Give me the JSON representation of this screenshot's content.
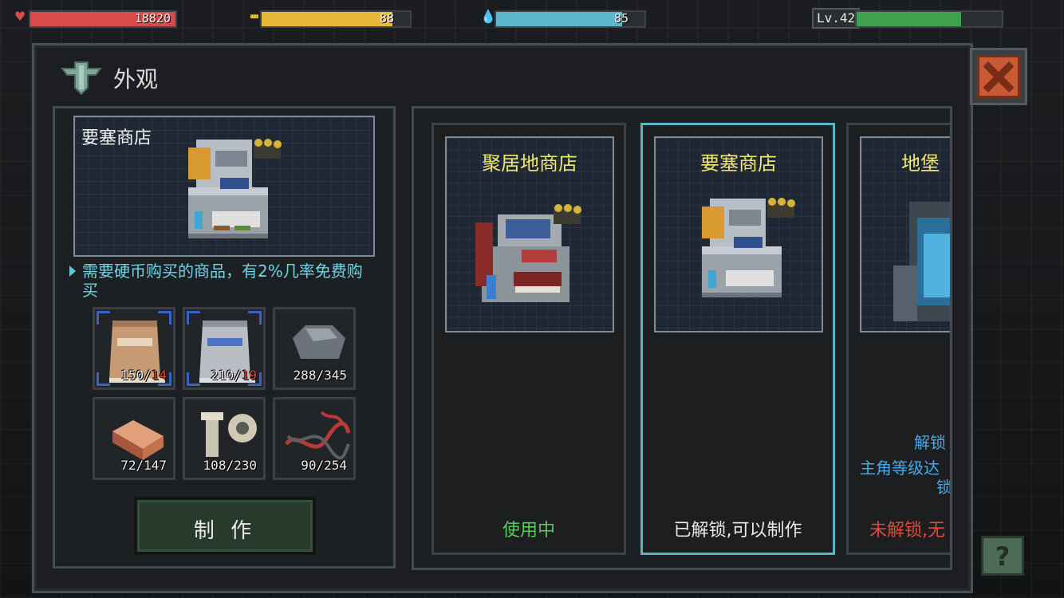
{
  "hud": {
    "health": {
      "value": "18820",
      "fill": 1.0,
      "color": "#d94a4a",
      "icon": "heart-icon"
    },
    "food": {
      "value": "88",
      "fill": 0.88,
      "color": "#e7b93a",
      "icon": "burger-icon"
    },
    "water": {
      "value": "85",
      "fill": 0.85,
      "color": "#5fb7cf",
      "icon": "water-drop-icon"
    },
    "level": {
      "label": "Lv.42",
      "fill": 0.72,
      "color": "#3fa04d"
    }
  },
  "panel": {
    "title": "外观",
    "title_icon": "build-emblem-icon"
  },
  "detail": {
    "preview_name": "要塞商店",
    "description": "需要硬币购买的商品，有2%几率免费购买",
    "materials": [
      {
        "name": "fabric-bag",
        "have": "150",
        "sep": "/",
        "need": "14",
        "need_red": true
      },
      {
        "name": "adhesive-bag",
        "have": "210",
        "sep": "/",
        "need": "19",
        "need_red": true
      },
      {
        "name": "stone",
        "have": "288",
        "sep": "/",
        "need": "345",
        "need_red": false
      },
      {
        "name": "copper-ingot",
        "have": "72",
        "sep": "/",
        "need": "147",
        "need_red": false
      },
      {
        "name": "bolt-nut",
        "have": "108",
        "sep": "/",
        "need": "230",
        "need_red": false
      },
      {
        "name": "wire",
        "have": "90",
        "sep": "/",
        "need": "254",
        "need_red": false
      }
    ],
    "make_button": "制 作"
  },
  "skins": [
    {
      "name": "聚居地商店",
      "status": "使用中",
      "status_color": "#5ec65e",
      "selected": false
    },
    {
      "name": "要塞商店",
      "status": "已解锁,可以制作",
      "status_color": "#e8e8e8",
      "selected": true
    },
    {
      "name": "地堡",
      "status": "未解锁,无",
      "status_color": "#e04a3a",
      "selected": false,
      "lock_line1": "解锁",
      "lock_line2": "主角等级达",
      "lock_line3": "锁"
    }
  ],
  "help_button": "?"
}
